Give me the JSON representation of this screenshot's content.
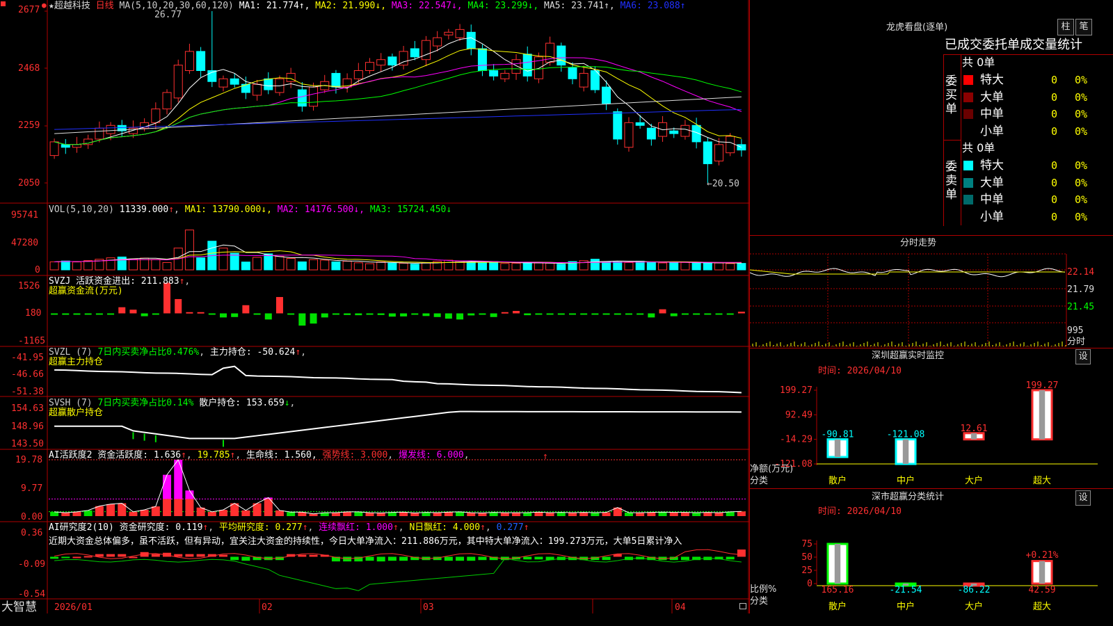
{
  "colors": {
    "up": "#ff3030",
    "down": "#00ffff",
    "bg": "#000000",
    "grid": "#b00000",
    "ma1": "#ffffff",
    "ma2": "#ffff00",
    "ma3": "#ff00ff",
    "ma4": "#00ff00",
    "ma5": "#dddddd",
    "ma6": "#2030ff",
    "accent": "#ffff00"
  },
  "header": {
    "title": "★超越科技",
    "period": "日线",
    "ma_label": "MA(5,10,20,30,60,120)",
    "ma_items": [
      {
        "text": "MA1: 21.774",
        "arrow": "↑",
        "color": "#ffffff"
      },
      {
        "text": "MA2: 21.990",
        "arrow": "↓",
        "color": "#ffff00"
      },
      {
        "text": "MA3: 22.547",
        "arrow": "↓",
        "color": "#ff00ff"
      },
      {
        "text": "MA4: 23.299",
        "arrow": "↓",
        "color": "#00ff00"
      },
      {
        "text": "MA5: 23.741",
        "arrow": "↑",
        "color": "#dddddd"
      },
      {
        "text": "MA6: 23.088",
        "arrow": "↑",
        "color": "#2030ff"
      }
    ],
    "high_note": "26.77",
    "low_note": "←20.50"
  },
  "price_axis": [
    "2677",
    "2468",
    "2259",
    "2050"
  ],
  "vol": {
    "label": "VOL(5,10,20)",
    "value": "11339.000",
    "arrow": "↑",
    "items": [
      {
        "text": "MA1: 13790.000",
        "arrow": "↓",
        "color": "#ffff00"
      },
      {
        "text": "MA2: 14176.500",
        "arrow": "↓",
        "color": "#ff00ff"
      },
      {
        "text": "MA3: 15724.450",
        "arrow": "↓",
        "color": "#00ff00"
      }
    ],
    "axis": [
      "95741",
      "47280",
      "0"
    ]
  },
  "svzj": {
    "label": "SVZJ  活跃资金进出: 211.883",
    "arrow": "↑",
    "sub": "超赢资金流(万元)",
    "axis": [
      "1526",
      "180",
      "-1165"
    ]
  },
  "svzl": {
    "label": "SVZL (7)",
    "pct": "7日内买卖净占比0.476%",
    "main": "主力持仓: -50.624",
    "arrow": "↑",
    "sub": "超赢主力持仓",
    "axis": [
      "-41.95",
      "-46.66",
      "-51.38"
    ]
  },
  "svsh": {
    "label": "SVSH (7)",
    "pct": "7日内买卖净占比0.14%",
    "main": "散户持仓: 153.659",
    "arrow": "↓",
    "sub": "超赢散户持仓",
    "axis": [
      "154.63",
      "148.96",
      "143.50"
    ]
  },
  "ai": {
    "label": "AI活跃度2 资金活跃度: 1.636",
    "a1": "↑",
    "v2": "19.785",
    "a2": "↑",
    "v3": "生命线: 1.560",
    "a3": ",",
    "v4": "强势线: 3.000",
    "v5": "爆发线: 6.000",
    "axis": [
      "19.78",
      "9.77",
      "0.00"
    ]
  },
  "ai2": {
    "label": "AI研究度2(10) 资金研究度: 0.119",
    "a1": "↑",
    "v2": "平均研究度: 0.277",
    "a2": "↑",
    "v3": "连续飘红: 1.000",
    "a3": "↑",
    "v4": "N日飘红: 4.000",
    "a4": "↑",
    "v5": "0.277",
    "a5": "↑",
    "desc": "近期大资金总体偏多，虽不活跃，但有异动，宜关注大资金的持续性，今日大单净流入：211.886万元，其中特大单净流入：199.273万元，大单5日累计净入",
    "axis": [
      "0.36",
      "-0.09",
      "-0.54"
    ]
  },
  "dates": {
    "app": "大智慧",
    "d1": "2026/01",
    "d2": "02",
    "d3": "03",
    "d4": "04"
  },
  "lhb": {
    "title": "龙虎看盘(逐单)",
    "btn1": "柱",
    "btn2": "笔",
    "subtitle": "已成交委托单成交量统计",
    "buy": {
      "side": "委买单",
      "total": "共 0单",
      "rows": [
        {
          "label": "特大",
          "v": "0",
          "p": "0%",
          "color": "#ff0000"
        },
        {
          "label": "大单",
          "v": "0",
          "p": "0%",
          "color": "#8b0000"
        },
        {
          "label": "中单",
          "v": "0",
          "p": "0%",
          "color": "#6a0000"
        },
        {
          "label": "小单",
          "v": "0",
          "p": "0%",
          "color": "#000000"
        }
      ]
    },
    "sell": {
      "side": "委卖单",
      "total": "共 0单",
      "rows": [
        {
          "label": "特大",
          "v": "0",
          "p": "0%",
          "color": "#00ffff"
        },
        {
          "label": "大单",
          "v": "0",
          "p": "0%",
          "color": "#008080"
        },
        {
          "label": "中单",
          "v": "0",
          "p": "0%",
          "color": "#006a6a"
        },
        {
          "label": "小单",
          "v": "0",
          "p": "0%",
          "color": "#000000"
        }
      ]
    }
  },
  "intraday": {
    "title": "分时走势",
    "axis": [
      "22.14",
      "21.79",
      "21.45",
      "995",
      "分时"
    ]
  },
  "monitor": {
    "title": "深圳超赢实时监控",
    "btn": "设",
    "time": "时间: 2026/04/10",
    "ylabel": "净额(万元)",
    "xlabel": "分类",
    "axis": [
      "199.27",
      "92.49",
      "-14.29",
      "-121.08"
    ]
  },
  "classify": {
    "title": "深市超赢分类统计",
    "btn": "设",
    "time": "时间: 2026/04/10",
    "ylabel": "比例%",
    "xlabel": "分类",
    "axis": [
      "75",
      "50",
      "25",
      "0"
    ],
    "pct_label": "+0.21%"
  },
  "chart_data": [
    {
      "type": "bar",
      "title": "深圳超赢实时监控",
      "categories": [
        "散户",
        "中户",
        "大户",
        "超大"
      ],
      "values": [
        -90.81,
        -121.08,
        12.61,
        199.27
      ],
      "ylim": [
        -121.08,
        199.27
      ]
    },
    {
      "type": "bar",
      "title": "深市超赢分类统计",
      "categories": [
        "散户",
        "中户",
        "大户",
        "超大"
      ],
      "values": [
        165.16,
        -21.54,
        -86.22,
        42.59
      ],
      "ylim": [
        0,
        75
      ]
    }
  ]
}
